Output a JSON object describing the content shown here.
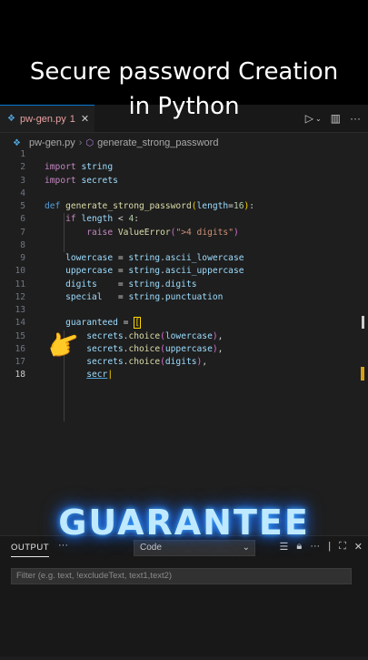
{
  "overlay": {
    "title_line1": "Secure password Creation",
    "title_line2": "in Python",
    "caption": "GUARANTEE"
  },
  "tab": {
    "filename": "pw-gen.py",
    "badge": "1",
    "close_glyph": "✕"
  },
  "breadcrumb": {
    "file": "pw-gen.py",
    "symbol": "generate_strong_password"
  },
  "code": {
    "line_numbers": [
      "1",
      "2",
      "3",
      "4",
      "5",
      "6",
      "7",
      "8",
      "9",
      "10",
      "11",
      "12",
      "13",
      "14",
      "15",
      "16",
      "17",
      "18"
    ],
    "active_line": "18",
    "lines": [
      "",
      "import string",
      "import secrets",
      "",
      "def generate_strong_password(length=16):",
      "    if length < 4:",
      "        raise ValueError(\">4 digits\")",
      "",
      "    lowercase = string.ascii_lowercase",
      "    uppercase = string.ascii_uppercase",
      "    digits    = string.digits",
      "    special   = string.punctuation",
      "",
      "    guaranteed = [",
      "        secrets.choice(lowercase),",
      "        secrets.choice(uppercase),",
      "        secrets.choice(digits),",
      "        secr"
    ]
  },
  "panel": {
    "output_tab": "OUTPUT",
    "more": "···",
    "channel_select": "Code",
    "filter_placeholder": "Filter (e.g. text, !excludeText, text1,text2)"
  },
  "colors": {
    "keyword": "#c586c0",
    "def": "#569cd6",
    "function": "#dcdcaa",
    "variable": "#9cdcfe",
    "number": "#b5cea8",
    "string": "#ce9178",
    "bracket": "#ffd700",
    "glow": "#3ba7ff"
  },
  "icons": {
    "file": "python-icon",
    "run": "run-icon",
    "split": "split-editor-icon",
    "hand": "pointing-hand-icon"
  }
}
